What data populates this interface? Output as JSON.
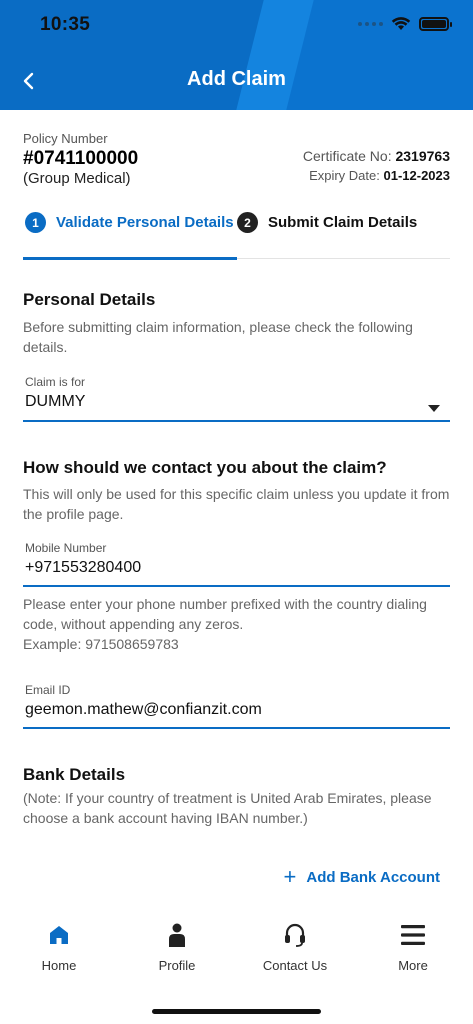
{
  "status_bar": {
    "time": "10:35"
  },
  "header": {
    "title": "Add Claim"
  },
  "policy": {
    "label": "Policy Number",
    "number": "#0741100000",
    "type": "(Group Medical)",
    "certificate_label": "Certificate No:",
    "certificate_value": "2319763",
    "expiry_label": "Expiry Date:",
    "expiry_value": "01-12-2023"
  },
  "steps": [
    {
      "num": "1",
      "label": "Validate Personal Details"
    },
    {
      "num": "2",
      "label": "Submit Claim Details"
    }
  ],
  "personal": {
    "heading": "Personal Details",
    "description": "Before submitting claim information, please check the following details.",
    "claim_for_label": "Claim is for",
    "claim_for_value": "DUMMY"
  },
  "contact": {
    "heading": "How should we contact you about the claim?",
    "description": "This will only be used for this specific claim unless you update it from the profile page.",
    "mobile_label": "Mobile Number",
    "mobile_value": "+971553280400",
    "mobile_hint_1": "Please enter your phone number prefixed with the country dialing code, without appending any zeros.",
    "mobile_hint_2": "Example: 971508659783",
    "email_label": "Email ID",
    "email_value": "geemon.mathew@confianzit.com"
  },
  "bank": {
    "heading": "Bank Details",
    "note": "(Note: If your country of treatment is United Arab Emirates, please choose a bank account having IBAN number.)",
    "add_label": "Add Bank Account"
  },
  "nav": [
    {
      "label": "Home",
      "icon": "home-icon",
      "active": true
    },
    {
      "label": "Profile",
      "icon": "person-icon"
    },
    {
      "label": "Contact Us",
      "icon": "headset-icon"
    },
    {
      "label": "More",
      "icon": "menu-icon"
    }
  ],
  "colors": {
    "primary": "#0a6cc4",
    "header_light": "#1484df"
  }
}
